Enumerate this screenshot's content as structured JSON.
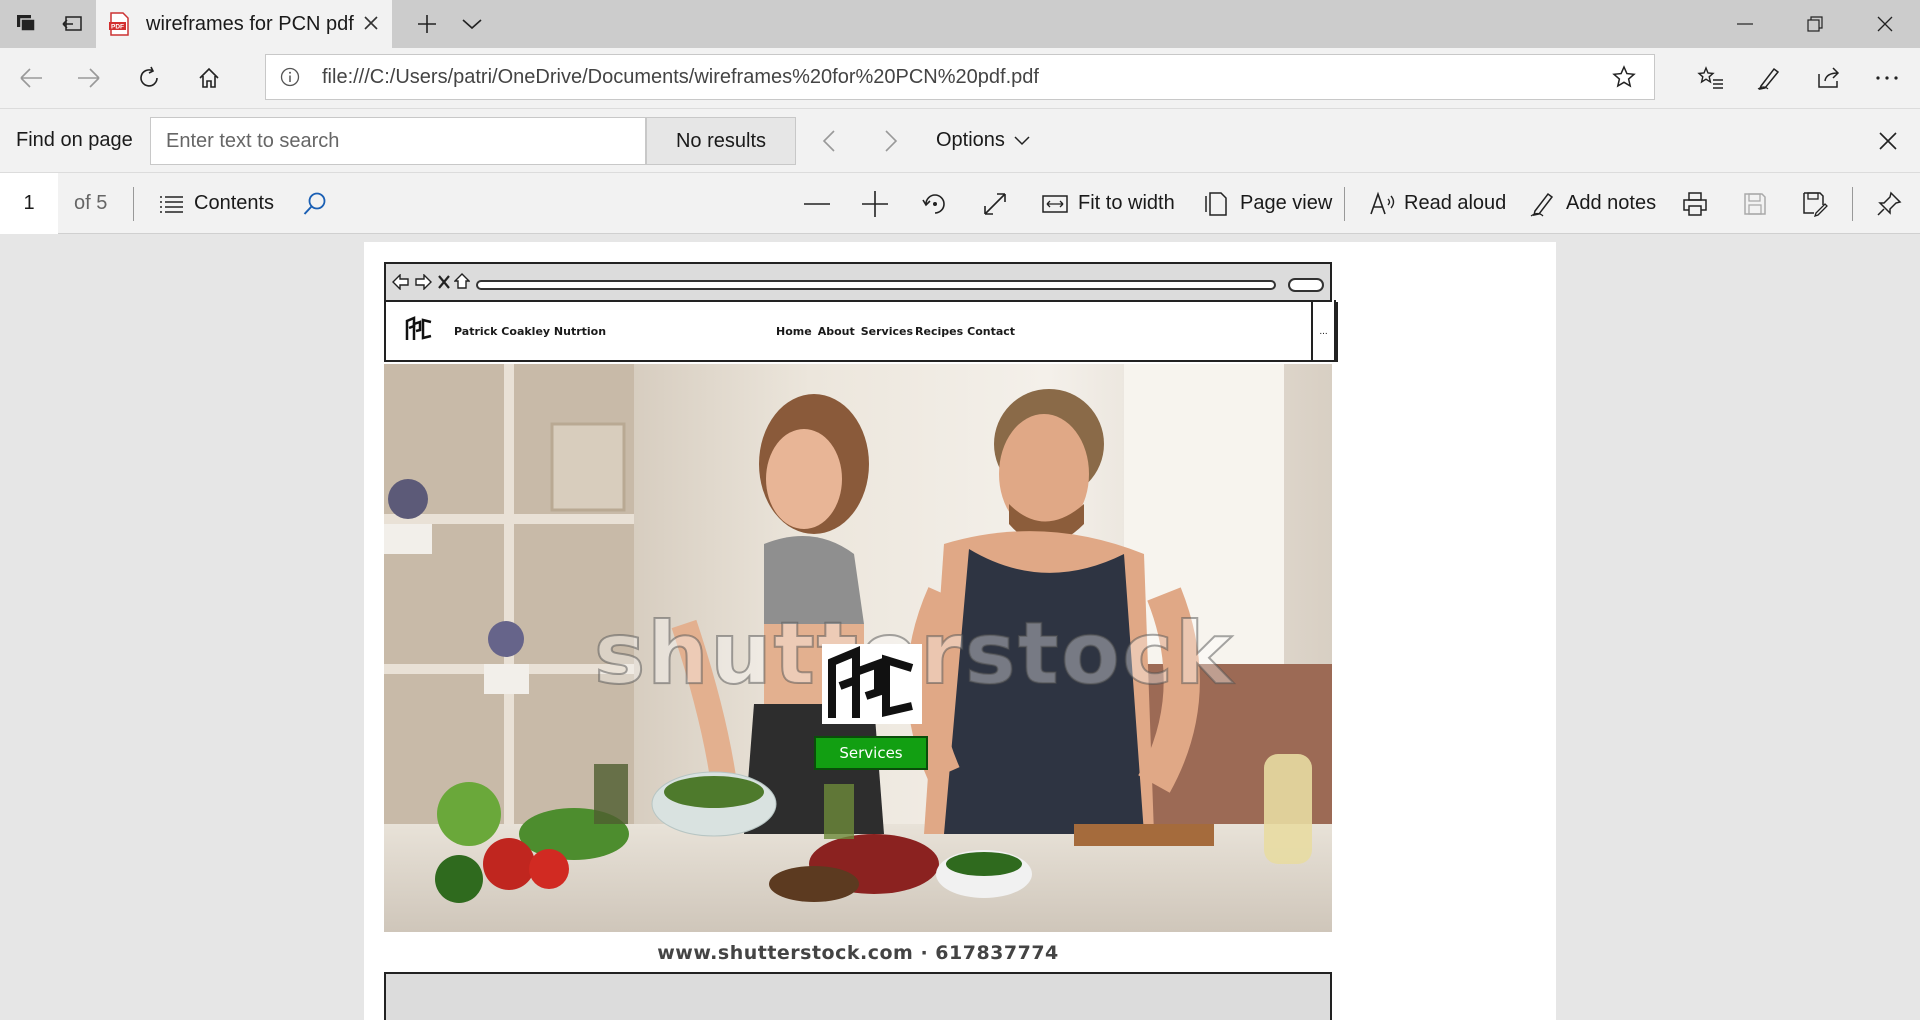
{
  "tab": {
    "title": "wireframes for PCN pdf"
  },
  "address_bar": {
    "url": "file:///C:/Users/patri/OneDrive/Documents/wireframes%20for%20PCN%20pdf.pdf"
  },
  "find_bar": {
    "label": "Find on page",
    "placeholder": "Enter text to search",
    "results": "No results",
    "options_label": "Options"
  },
  "pdf_toolbar": {
    "page_number": "1",
    "page_total": "of 5",
    "contents_label": "Contents",
    "fit_to_width_label": "Fit to width",
    "page_view_label": "Page view",
    "read_aloud_label": "Read aloud",
    "add_notes_label": "Add notes"
  },
  "wireframe": {
    "brand": "Patrick Coakley Nutrtion",
    "nav_links": [
      "Home",
      "About",
      "Services",
      "Recipes",
      "Contact"
    ],
    "menu_glyph": "...",
    "watermark": "shutterstock",
    "services_button": "Services",
    "caption": "www.shutterstock.com · 617837774"
  },
  "colors": {
    "tab_bar": "#cccccc",
    "toolbar": "#f2f2f2",
    "services_green": "#129f12"
  }
}
